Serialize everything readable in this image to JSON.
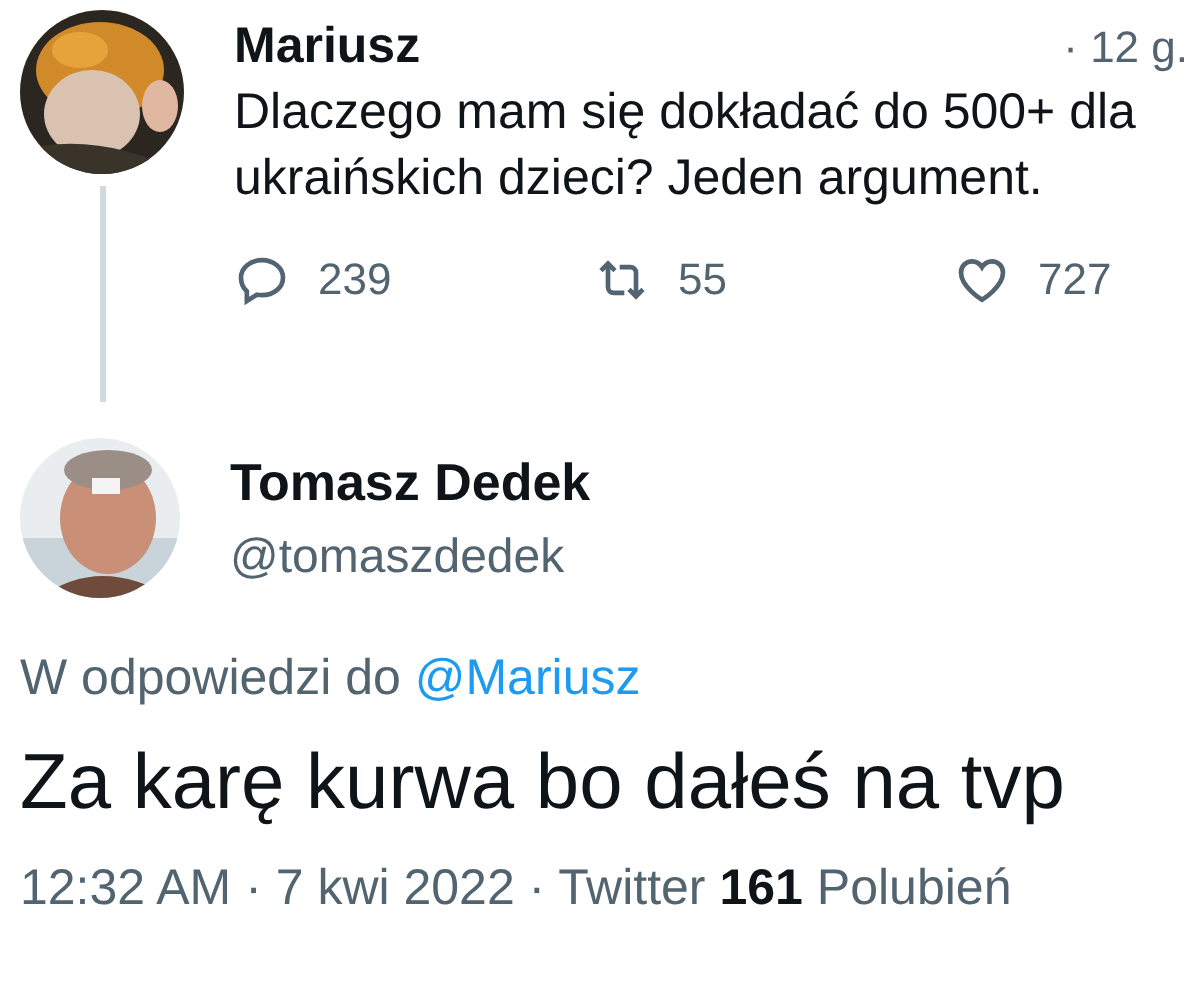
{
  "tweet": {
    "author": "Mariusz",
    "time": "· 12 g.",
    "text": "Dlaczego mam się dokładać do 500+ dla ukraińskich dzieci? Jeden argument.",
    "actions": [
      {
        "kind": "reply",
        "count": "239"
      },
      {
        "kind": "retweet",
        "count": "55"
      },
      {
        "kind": "like",
        "count": "727"
      }
    ]
  },
  "reply": {
    "author": "Tomasz Dedek",
    "handle": "@tomaszdedek",
    "replying_to": "W odpowiedzi do",
    "replying_to_user": "@Mariusz",
    "text": "Za karę kurwa bo dałeś na tvp",
    "time": "12:32 AM · 7 kwi 2022 · Twitter",
    "likes_count": "161",
    "likes_label": "Polubień"
  }
}
